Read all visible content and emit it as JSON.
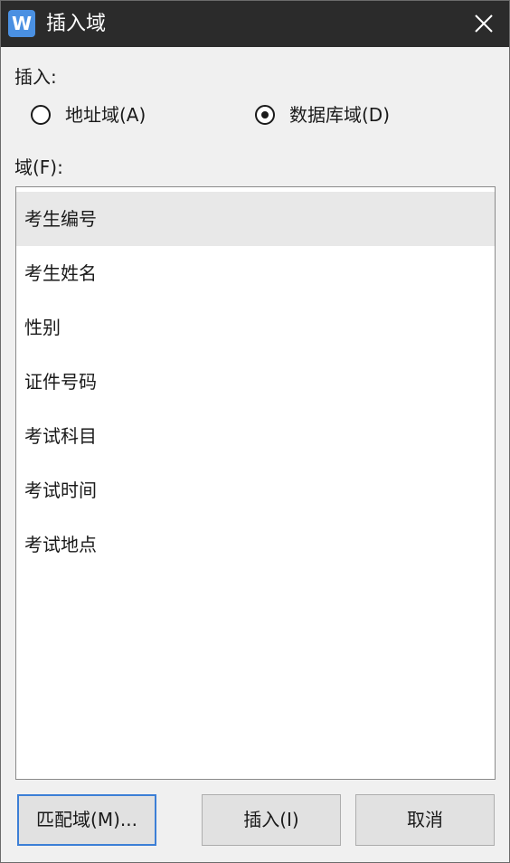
{
  "window": {
    "title": "插入域",
    "app_icon_letter": "W",
    "close_glyph": "close-icon"
  },
  "insert_group": {
    "label": "插入:",
    "options": [
      {
        "label": "地址域(A)",
        "checked": false
      },
      {
        "label": "数据库域(D)",
        "checked": true
      }
    ]
  },
  "fields": {
    "label": "域(F):",
    "items": [
      {
        "label": "考生编号",
        "selected": true
      },
      {
        "label": "考生姓名",
        "selected": false
      },
      {
        "label": "性别",
        "selected": false
      },
      {
        "label": "证件号码",
        "selected": false
      },
      {
        "label": "考试科目",
        "selected": false
      },
      {
        "label": "考试时间",
        "selected": false
      },
      {
        "label": "考试地点",
        "selected": false
      }
    ]
  },
  "buttons": {
    "match": "匹配域(M)...",
    "insert": "插入(I)",
    "cancel": "取消"
  },
  "colors": {
    "titlebar": "#2b2b2b",
    "app_icon": "#4a90e2",
    "selected_row": "#e8e8e8",
    "focus_border": "#3c7fd6"
  }
}
